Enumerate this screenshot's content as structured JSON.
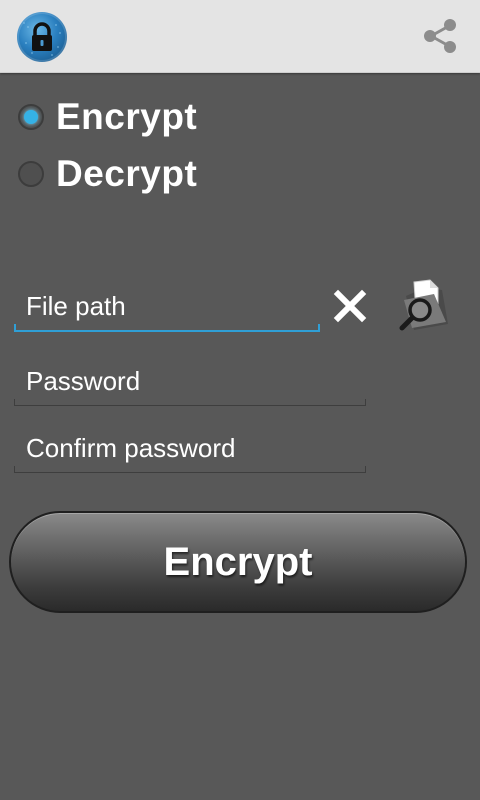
{
  "actionbar": {
    "app_icon": "lock-icon",
    "share_icon": "share-icon"
  },
  "mode": {
    "options": [
      {
        "label": "Encrypt",
        "checked": true
      },
      {
        "label": "Decrypt",
        "checked": false
      }
    ]
  },
  "form": {
    "file_path_placeholder": "File path",
    "password_placeholder": "Password",
    "confirm_placeholder": "Confirm password",
    "clear_icon": "close-icon",
    "browse_icon": "folder-search-icon"
  },
  "action": {
    "label": "Encrypt"
  },
  "colors": {
    "accent": "#35b2e6",
    "background": "#585858",
    "actionbar": "#e4e4e4"
  }
}
